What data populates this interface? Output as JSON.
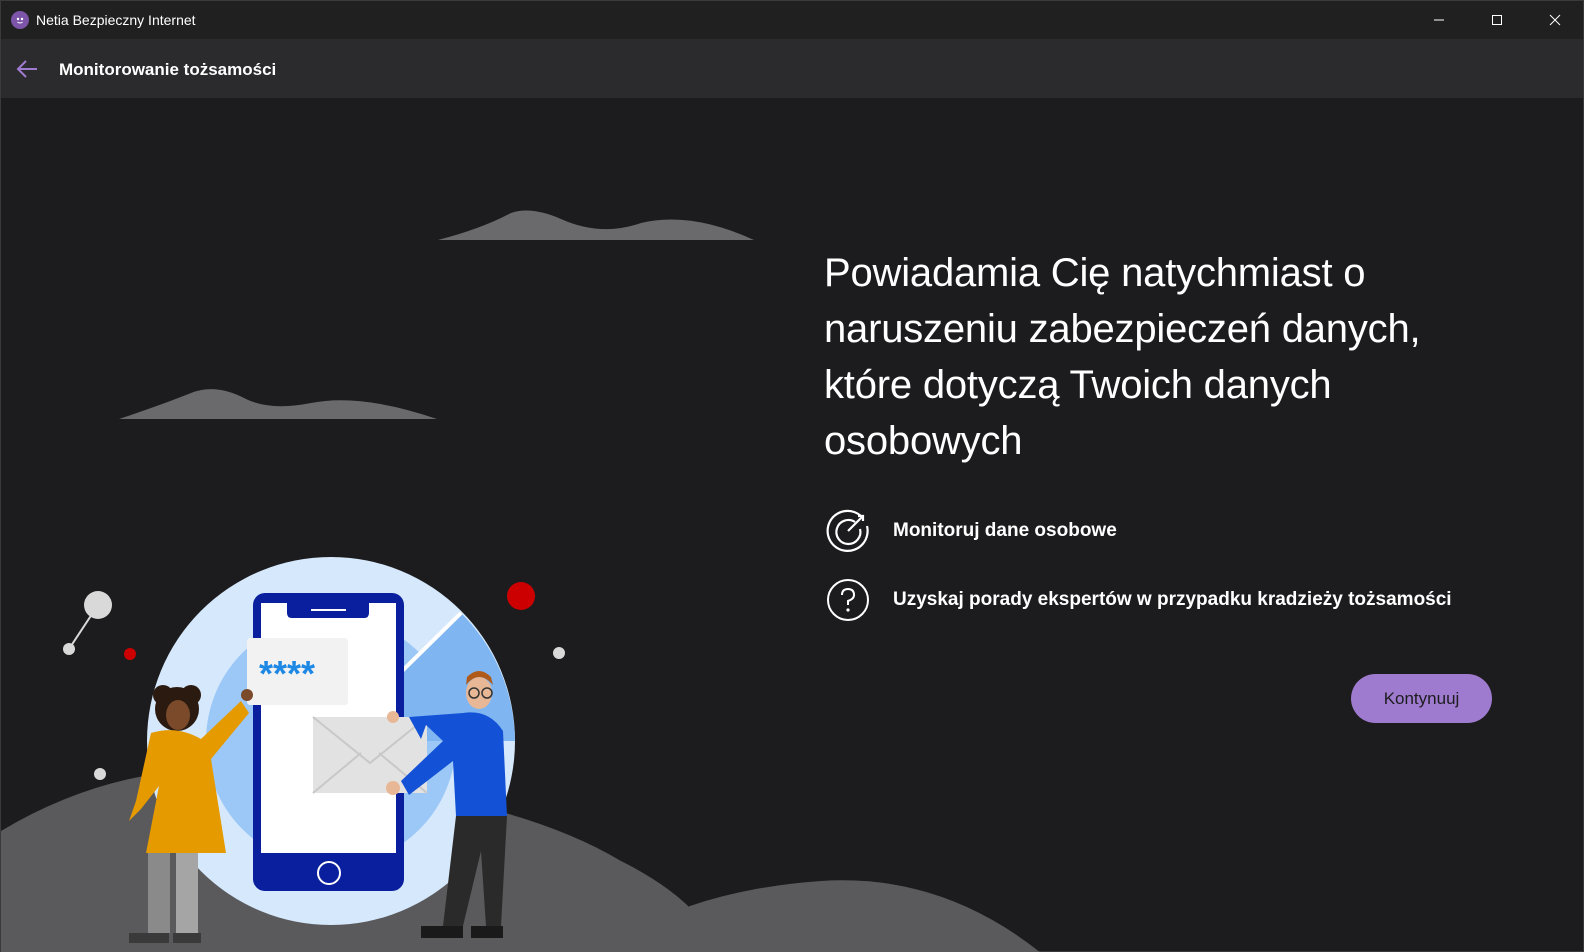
{
  "window": {
    "title": "Netia Bezpieczny Internet",
    "controls": [
      "minimize-icon",
      "maximize-icon",
      "close-icon"
    ]
  },
  "header": {
    "back_icon": "arrow-left-icon",
    "title": "Monitorowanie tożsamości"
  },
  "main": {
    "headline": "Powiadamia Cię natychmiast o naruszeniu zabezpieczeń danych, które dotyczą Twoich danych osobowych",
    "features": [
      {
        "icon": "target-radar-icon",
        "label": "Monitoruj dane osobowe"
      },
      {
        "icon": "question-circle-icon",
        "label": "Uzyskaj porady ekspertów w przypadku kradzieży tożsamości"
      }
    ],
    "continue_label": "Kontynuuj",
    "illustration": {
      "phone_password": "****"
    }
  },
  "colors": {
    "accent": "#9f7bcf",
    "background": "#1c1c1e",
    "header": "#2b2b2d",
    "titlebar": "#202020"
  }
}
